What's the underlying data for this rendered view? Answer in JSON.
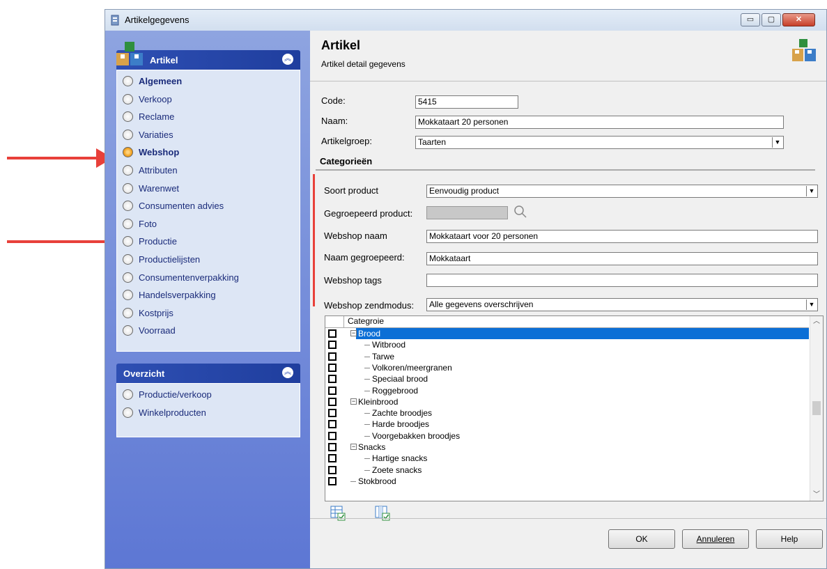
{
  "window": {
    "title": "Artikelgegevens",
    "controls": {
      "minimize": "▭",
      "maximize": "▢",
      "close": "✕"
    }
  },
  "sidebar": {
    "artikel_panel": {
      "title": "Artikel",
      "items": [
        {
          "label": "Algemeen",
          "bold": true,
          "selected": false
        },
        {
          "label": "Verkoop",
          "bold": false,
          "selected": false
        },
        {
          "label": "Reclame",
          "bold": false,
          "selected": false
        },
        {
          "label": "Variaties",
          "bold": false,
          "selected": false
        },
        {
          "label": "Webshop",
          "bold": true,
          "selected": true
        },
        {
          "label": "Attributen",
          "bold": false,
          "selected": false
        },
        {
          "label": "Warenwet",
          "bold": false,
          "selected": false
        },
        {
          "label": "Consumenten advies",
          "bold": false,
          "selected": false
        },
        {
          "label": "Foto",
          "bold": false,
          "selected": false
        },
        {
          "label": "Productie",
          "bold": false,
          "selected": false
        },
        {
          "label": "Productielijsten",
          "bold": false,
          "selected": false
        },
        {
          "label": "Consumentenverpakking",
          "bold": false,
          "selected": false
        },
        {
          "label": "Handelsverpakking",
          "bold": false,
          "selected": false
        },
        {
          "label": "Kostprijs",
          "bold": false,
          "selected": false
        },
        {
          "label": "Voorraad",
          "bold": false,
          "selected": false
        }
      ]
    },
    "overzicht_panel": {
      "title": "Overzicht",
      "items": [
        {
          "label": "Productie/verkoop"
        },
        {
          "label": "Winkelproducten"
        }
      ]
    }
  },
  "header": {
    "title": "Artikel",
    "subtitle": "Artikel detail gegevens"
  },
  "form": {
    "code_label": "Code:",
    "code_value": "5415",
    "naam_label": "Naam:",
    "naam_value": "Mokkataart 20 personen",
    "artikelgroep_label": "Artikelgroep:",
    "artikelgroep_value": "Taarten"
  },
  "categorieen": {
    "title": "Categorieën",
    "soort_product_label": "Soort product",
    "soort_product_value": "Eenvoudig product",
    "gegroepeerd_label": "Gegroepeerd product:",
    "gegroepeerd_value": "",
    "webshop_naam_label": "Webshop naam",
    "webshop_naam_value": "Mokkataart voor 20 personen",
    "naam_gegroepeerd_label": "Naam gegroepeerd:",
    "naam_gegroepeerd_value": "Mokkataart",
    "webshop_tags_label": "Webshop tags",
    "webshop_tags_value": "",
    "zendmodus_label": "Webshop zendmodus:",
    "zendmodus_value": "Alle gegevens overschrijven"
  },
  "tree": {
    "column_header": "Categroie",
    "rows": [
      {
        "label": "Brood",
        "level": 0,
        "expander": "−",
        "selected": true
      },
      {
        "label": "Witbrood",
        "level": 1
      },
      {
        "label": "Tarwe",
        "level": 1
      },
      {
        "label": "Volkoren/meergranen",
        "level": 1
      },
      {
        "label": "Speciaal brood",
        "level": 1
      },
      {
        "label": "Roggebrood",
        "level": 1
      },
      {
        "label": "Kleinbrood",
        "level": 0,
        "expander": "−"
      },
      {
        "label": "Zachte broodjes",
        "level": 1
      },
      {
        "label": "Harde broodjes",
        "level": 1
      },
      {
        "label": "Voorgebakken broodjes",
        "level": 1
      },
      {
        "label": "Snacks",
        "level": 0,
        "expander": "−"
      },
      {
        "label": "Hartige snacks",
        "level": 1
      },
      {
        "label": "Zoete snacks",
        "level": 1
      },
      {
        "label": "Stokbrood",
        "level": 0
      }
    ]
  },
  "buttons": {
    "ok": "OK",
    "cancel": "Annuleren",
    "help": "Help"
  },
  "colors": {
    "accent_red": "#e8403a",
    "panel_header": "#2e4fb3",
    "selection": "#0c6fd6"
  }
}
